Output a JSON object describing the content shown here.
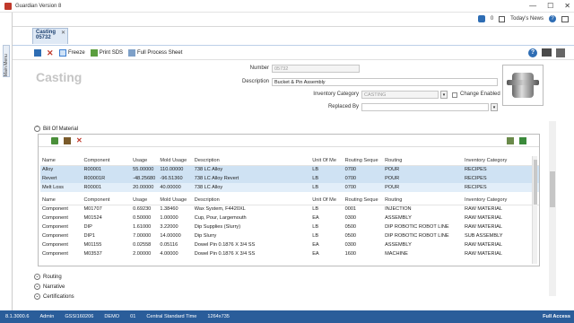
{
  "app": {
    "title": "Guardian Version 8"
  },
  "window_controls": {
    "minimize": "—",
    "maximize": "☐",
    "close": "✕"
  },
  "news": {
    "count": "0",
    "label": "Today's News"
  },
  "left_tab": {
    "label": "Main Menu"
  },
  "doc_tab": {
    "title": "Casting",
    "subtitle": "05732",
    "close": "✕"
  },
  "toolbar": {
    "freeze_label": "Freeze",
    "print_sds_label": "Print SDS",
    "full_process_label": "Full Process Sheet",
    "help_icon": "?"
  },
  "header": {
    "title": "Casting",
    "number_label": "Number",
    "number_value": "05732",
    "description_label": "Description",
    "description_value": "Bucket & Pin Assembly",
    "inventory_category_label": "Inventory Category",
    "inventory_category_value": "CASTING",
    "change_enabled_label": "Change Enabled",
    "replaced_by_label": "Replaced By",
    "replaced_by_value": ""
  },
  "bom": {
    "section_label": "Bill Of Material",
    "columns": [
      "Name",
      "Component",
      "Usage",
      "Mold Usage",
      "Description",
      "Unit Of Me",
      "Routing Seque",
      "Routing",
      "Inventory Category"
    ],
    "top_rows": [
      [
        "Alloy",
        "R00001",
        "55.00000",
        "110.00000",
        "738 LC Alloy",
        "LB",
        "0700",
        "POUR",
        "RECIPES"
      ],
      [
        "Revert",
        "R00001R",
        "-48.25680",
        "-96.51360",
        "738 LC Alloy Revert",
        "LB",
        "0700",
        "POUR",
        "RECIPES"
      ],
      [
        "Melt Loss",
        "R00001",
        "20.00000",
        "40.00000",
        "738 LC Alloy",
        "LB",
        "0700",
        "POUR",
        "RECIPES"
      ]
    ],
    "bottom_rows": [
      [
        "Component",
        "M01707",
        "0.69230",
        "1.38460",
        "Wax System, F4420XL",
        "LB",
        "0001",
        "INJECTION",
        "RAW MATERIAL"
      ],
      [
        "Component",
        "M01524",
        "0.50000",
        "1.00000",
        "Cup, Pour, Largemouth",
        "EA",
        "0300",
        "ASSEMBLY",
        "RAW MATERIAL"
      ],
      [
        "Component",
        "DIP",
        "1.61000",
        "3.22000",
        "Dip Supplies (Slurry)",
        "LB",
        "0500",
        "DIP ROBOTIC ROBOT LINE",
        "RAW MATERIAL"
      ],
      [
        "Component",
        "DIP1",
        "7.00000",
        "14.00000",
        "Dip Slurry",
        "LB",
        "0500",
        "DIP ROBOTIC ROBOT LINE",
        "SUB ASSEMBLY"
      ],
      [
        "Component",
        "M01155",
        "0.02558",
        "0.05116",
        "Dowel Pin 0.1876 X 3/4 SS",
        "EA",
        "0300",
        "ASSEMBLY",
        "RAW MATERIAL"
      ],
      [
        "Component",
        "M03537",
        "2.00000",
        "4.00000",
        "Dowel Pin 0.1876 X 3/4 SS",
        "EA",
        "1600",
        "MACHINE",
        "RAW MATERIAL"
      ]
    ]
  },
  "sections": {
    "routing": "Routing",
    "narrative": "Narrative",
    "certifications": "Certifications"
  },
  "status": {
    "version": "8.1.3000.6",
    "user": "Admin",
    "server": "GSSI160206",
    "company": "DEMO",
    "site": "01",
    "timezone": "Central Standard Time",
    "resolution": "1264x735",
    "access": "Full Access"
  }
}
